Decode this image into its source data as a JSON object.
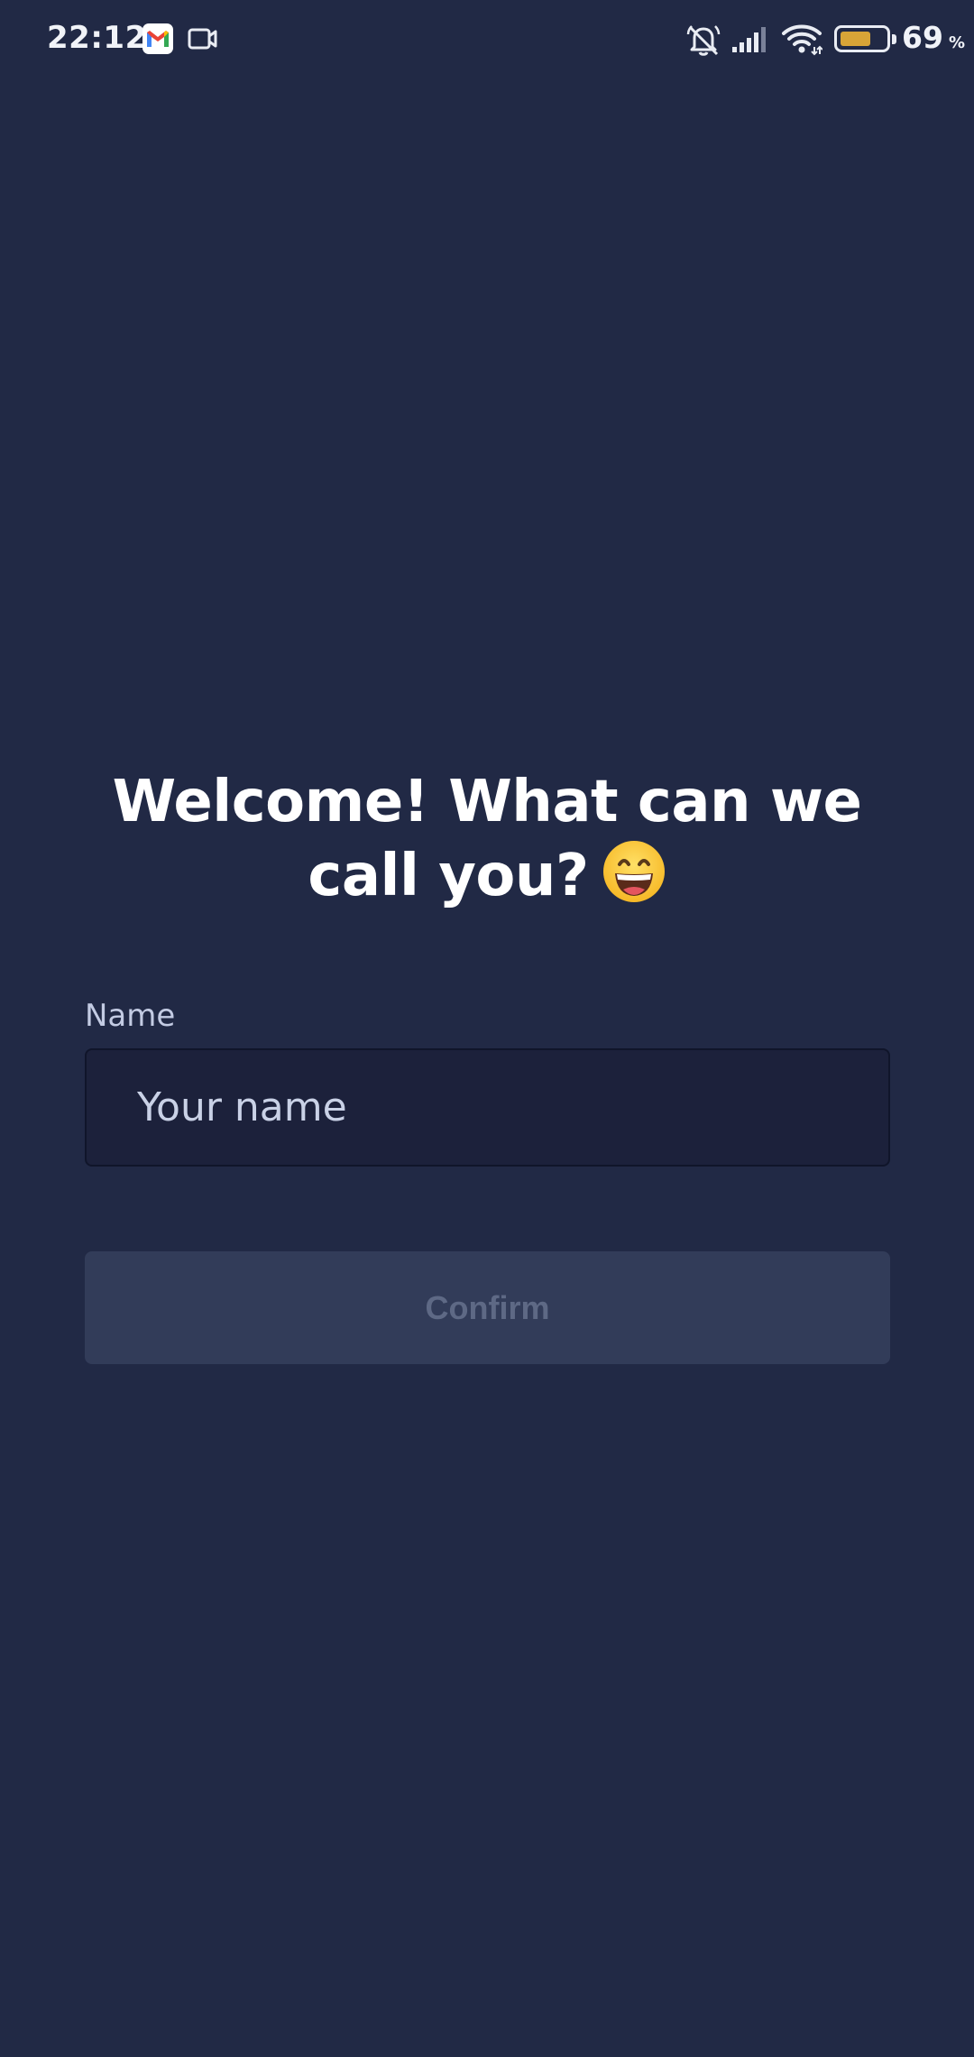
{
  "status_bar": {
    "time": "22:12",
    "battery_percent": "69",
    "battery_unit": "%",
    "battery_level": 0.69,
    "battery_color": "#d8a437",
    "icons": [
      "gmail-icon",
      "video-icon",
      "silent-bell-icon",
      "signal-icon",
      "wifi-icon",
      "battery-icon"
    ]
  },
  "main": {
    "title": "Welcome! What can we call you?",
    "title_emoji": "grinning-face-with-smiling-eyes",
    "name_label": "Name",
    "name_input": {
      "value": "",
      "placeholder": "Your name"
    },
    "confirm_label": "Confirm"
  },
  "colors": {
    "background": "#212945",
    "input_background": "#1c213b",
    "button_disabled_background": "#323c59",
    "button_disabled_text": "#5e6985"
  }
}
